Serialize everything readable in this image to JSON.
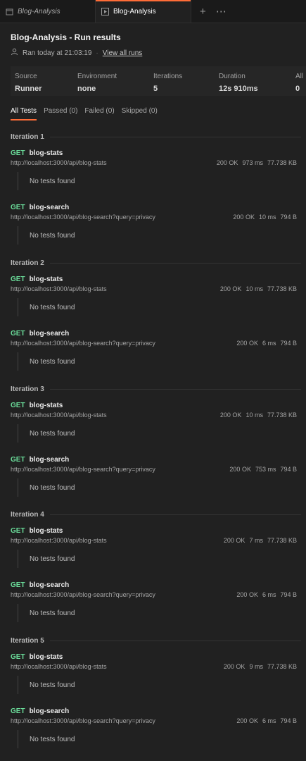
{
  "tabs": [
    {
      "label": "Blog-Analysis",
      "icon": "collection-icon"
    },
    {
      "label": "Blog-Analysis",
      "icon": "runner-icon"
    }
  ],
  "tab_actions": {
    "add": "+",
    "more": "⋯"
  },
  "header": {
    "title": "Blog-Analysis - Run results",
    "ran": "Ran today at 21:03:19",
    "sep": "·",
    "view_all": "View all runs"
  },
  "stats": [
    {
      "label": "Source",
      "value": "Runner"
    },
    {
      "label": "Environment",
      "value": "none"
    },
    {
      "label": "Iterations",
      "value": "5"
    },
    {
      "label": "Duration",
      "value": "12s 910ms"
    },
    {
      "label": "All",
      "value": "0"
    }
  ],
  "filters": [
    "All Tests",
    "Passed (0)",
    "Failed (0)",
    "Skipped (0)"
  ],
  "no_tests": "No tests found",
  "accent": "#ff6c37",
  "method_color": "#6bdd9a",
  "iterations": [
    {
      "label": "Iteration 1",
      "requests": [
        {
          "method": "GET",
          "name": "blog-stats",
          "url": "http://localhost:3000/api/blog-stats",
          "status": "200 OK",
          "time": "973 ms",
          "size": "77.738 KB"
        },
        {
          "method": "GET",
          "name": "blog-search",
          "url": "http://localhost:3000/api/blog-search?query=privacy",
          "status": "200 OK",
          "time": "10 ms",
          "size": "794 B"
        }
      ]
    },
    {
      "label": "Iteration 2",
      "requests": [
        {
          "method": "GET",
          "name": "blog-stats",
          "url": "http://localhost:3000/api/blog-stats",
          "status": "200 OK",
          "time": "10 ms",
          "size": "77.738 KB"
        },
        {
          "method": "GET",
          "name": "blog-search",
          "url": "http://localhost:3000/api/blog-search?query=privacy",
          "status": "200 OK",
          "time": "6 ms",
          "size": "794 B"
        }
      ]
    },
    {
      "label": "Iteration 3",
      "requests": [
        {
          "method": "GET",
          "name": "blog-stats",
          "url": "http://localhost:3000/api/blog-stats",
          "status": "200 OK",
          "time": "10 ms",
          "size": "77.738 KB"
        },
        {
          "method": "GET",
          "name": "blog-search",
          "url": "http://localhost:3000/api/blog-search?query=privacy",
          "status": "200 OK",
          "time": "753 ms",
          "size": "794 B"
        }
      ]
    },
    {
      "label": "Iteration 4",
      "requests": [
        {
          "method": "GET",
          "name": "blog-stats",
          "url": "http://localhost:3000/api/blog-stats",
          "status": "200 OK",
          "time": "7 ms",
          "size": "77.738 KB"
        },
        {
          "method": "GET",
          "name": "blog-search",
          "url": "http://localhost:3000/api/blog-search?query=privacy",
          "status": "200 OK",
          "time": "6 ms",
          "size": "794 B"
        }
      ]
    },
    {
      "label": "Iteration 5",
      "requests": [
        {
          "method": "GET",
          "name": "blog-stats",
          "url": "http://localhost:3000/api/blog-stats",
          "status": "200 OK",
          "time": "9 ms",
          "size": "77.738 KB"
        },
        {
          "method": "GET",
          "name": "blog-search",
          "url": "http://localhost:3000/api/blog-search?query=privacy",
          "status": "200 OK",
          "time": "6 ms",
          "size": "794 B"
        }
      ]
    }
  ]
}
